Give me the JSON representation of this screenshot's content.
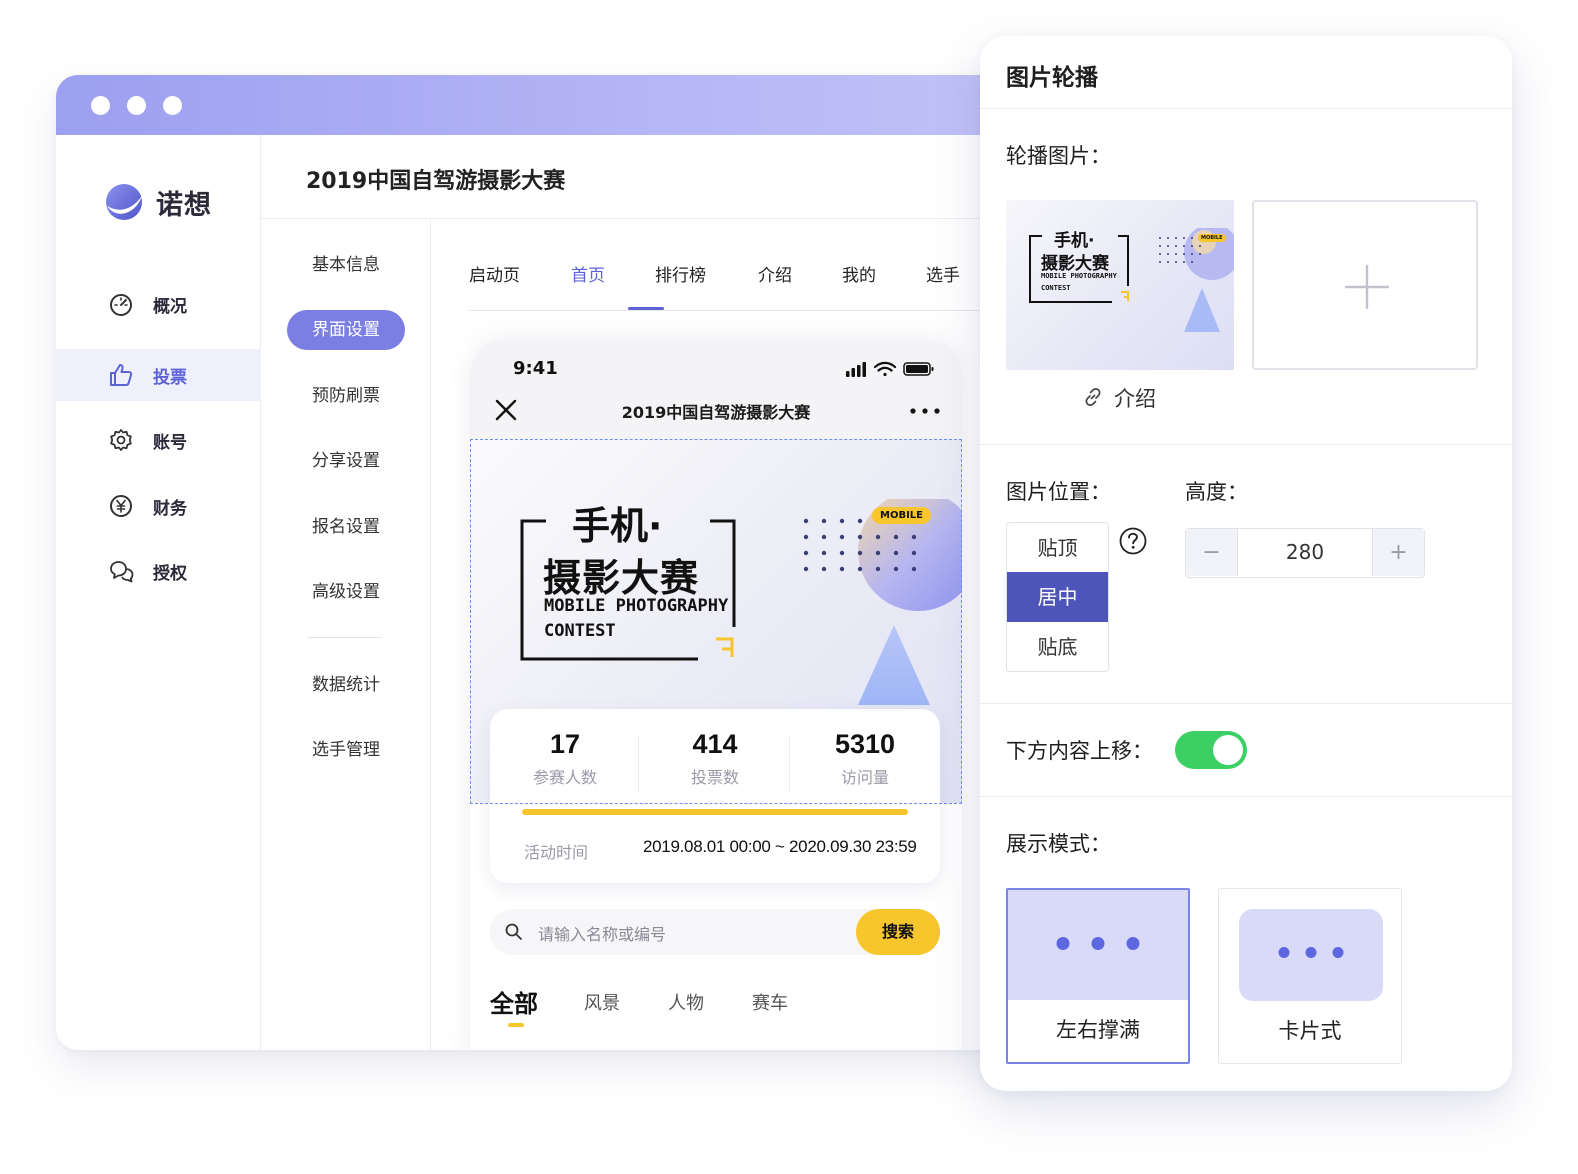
{
  "app": {
    "brand": "诺想",
    "project_title": "2019中国自驾游摄影大赛"
  },
  "sidebar": {
    "items": [
      {
        "label": "概况",
        "icon": "dashboard-icon"
      },
      {
        "label": "投票",
        "icon": "thumbs-up-icon",
        "active": true
      },
      {
        "label": "账号",
        "icon": "gear-icon"
      },
      {
        "label": "财务",
        "icon": "yen-icon"
      },
      {
        "label": "授权",
        "icon": "chat-bubbles-icon"
      }
    ]
  },
  "subnav": {
    "items": [
      {
        "label": "基本信息"
      },
      {
        "label": "界面设置",
        "active": true
      },
      {
        "label": "预防刷票"
      },
      {
        "label": "分享设置"
      },
      {
        "label": "报名设置"
      },
      {
        "label": "高级设置"
      },
      {
        "label": "数据统计"
      },
      {
        "label": "选手管理"
      }
    ]
  },
  "tabs": {
    "items": [
      {
        "label": "启动页"
      },
      {
        "label": "首页",
        "active": true
      },
      {
        "label": "排行榜"
      },
      {
        "label": "介绍"
      },
      {
        "label": "我的"
      },
      {
        "label": "选手"
      }
    ]
  },
  "phone": {
    "time": "9:41",
    "title": "2019中国自驾游摄影大赛",
    "banner": {
      "line1": "手机·",
      "line2": "摄影大赛",
      "line3": "MOBILE PHOTOGRAPHY",
      "line4": "CONTEST",
      "badge": "MOBILE"
    },
    "stats": [
      {
        "value": "17",
        "label": "参赛人数"
      },
      {
        "value": "414",
        "label": "投票数"
      },
      {
        "value": "5310",
        "label": "访问量"
      }
    ],
    "activity": {
      "label": "活动时间",
      "value": "2019.08.01 00:00 ~ 2020.09.30 23:59"
    },
    "search": {
      "placeholder": "请输入名称或编号",
      "button": "搜索"
    },
    "categories": [
      {
        "label": "全部",
        "active": true
      },
      {
        "label": "风景"
      },
      {
        "label": "人物"
      },
      {
        "label": "赛车"
      }
    ]
  },
  "panel": {
    "title": "图片轮播",
    "carousel_label": "轮播图片：",
    "thumb": {
      "line1": "手机·",
      "line2": "摄影大赛",
      "line3": "MOBILE PHOTOGRAPHY",
      "line4": "CONTEST",
      "badge": "MOBILE"
    },
    "link_text": "介绍",
    "position_label": "图片位置：",
    "position_options": [
      {
        "label": "贴顶"
      },
      {
        "label": "居中",
        "active": true
      },
      {
        "label": "贴底"
      }
    ],
    "height_label": "高度：",
    "height": {
      "minus": "−",
      "value": "280",
      "plus": "+"
    },
    "shift_label": "下方内容上移：",
    "shift_enabled": true,
    "mode_label": "展示模式：",
    "modes": [
      {
        "label": "左右撑满",
        "active": true
      },
      {
        "label": "卡片式"
      }
    ]
  },
  "colors": {
    "accent": "#5d62d6",
    "titlebar": "#a6a8f2",
    "yellow": "#f7c52c",
    "toggle_on": "#3ccf64",
    "position_active": "#4e55b9"
  }
}
